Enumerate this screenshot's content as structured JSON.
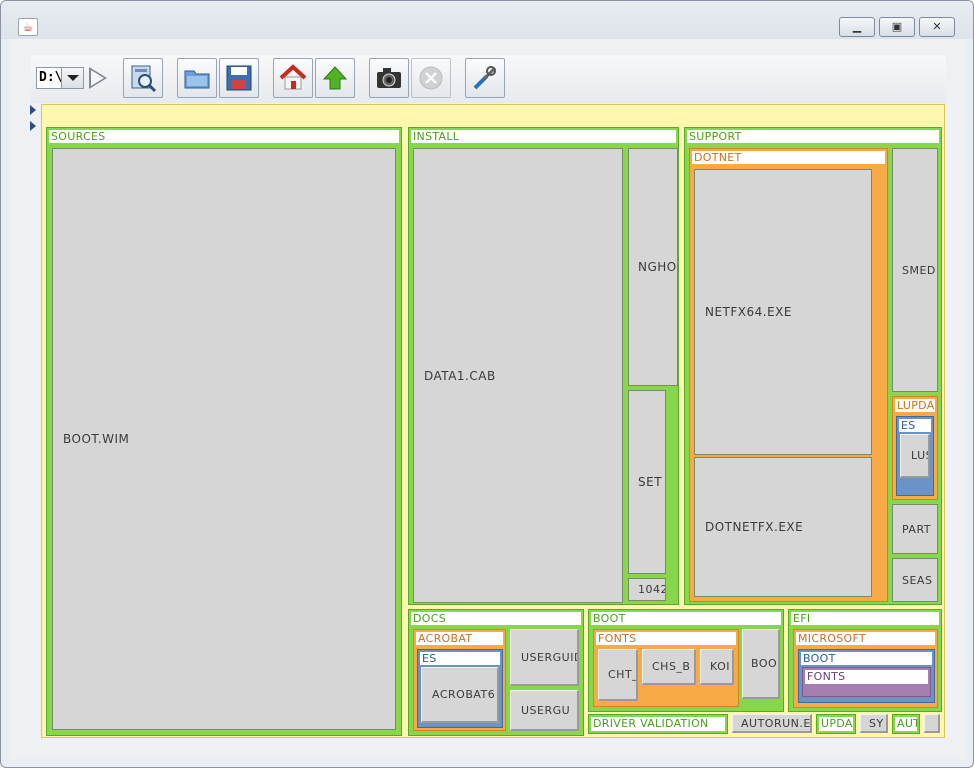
{
  "window": {
    "title_icon": "java-cup-icon",
    "controls": {
      "minimize": "minimize-icon",
      "maximize": "maximize-icon",
      "close": "close-icon"
    }
  },
  "toolbar": {
    "drive": "D:\\",
    "buttons": [
      "play-icon",
      "scan-icon",
      "open-folder-icon",
      "save-icon",
      "home-icon",
      "up-arrow-icon",
      "camera-icon",
      "stop-icon",
      "settings-tools-icon"
    ]
  },
  "treemap": {
    "sources": {
      "label": "SOURCES",
      "files": {
        "boot_wim": "BOOT.WIM"
      }
    },
    "install": {
      "label": "INSTALL",
      "files": {
        "data1": "DATA1.CAB",
        "ngho": "NGHO",
        "set": "SET",
        "f1042": "1042"
      }
    },
    "support": {
      "label": "SUPPORT",
      "dotnet": {
        "label": "DOTNET",
        "files": {
          "netfx64": "NETFX64.EXE",
          "dotnetfx": "DOTNETFX.EXE"
        }
      },
      "smed": "SMED",
      "lupda": {
        "label": "LUPDA",
        "es": {
          "label": "ES",
          "file": "LUS"
        }
      },
      "part": "PART",
      "seas": "SEAS"
    },
    "docs": {
      "label": "DOCS",
      "acrobat": {
        "label": "ACROBAT",
        "es": {
          "label": "ES",
          "file": "ACROBAT6"
        }
      },
      "userguid1": "USERGUID",
      "userguid2": "USERGU"
    },
    "boot": {
      "label": "BOOT",
      "fonts": {
        "label": "FONTS",
        "files": {
          "cht": "CHT_",
          "chs": "CHS_B",
          "kor": "KOI"
        }
      },
      "boo": "BOO"
    },
    "efi": {
      "label": "EFI",
      "microsoft": {
        "label": "MICROSOFT",
        "boot": {
          "label": "BOOT",
          "fonts": {
            "label": "FONTS"
          }
        }
      }
    },
    "bottom": {
      "driver_validation": "DRIVER VALIDATION",
      "autorun": "AUTORUN.E",
      "upda": "UPDA",
      "sy": "SY",
      "aut": "AUT"
    }
  }
}
